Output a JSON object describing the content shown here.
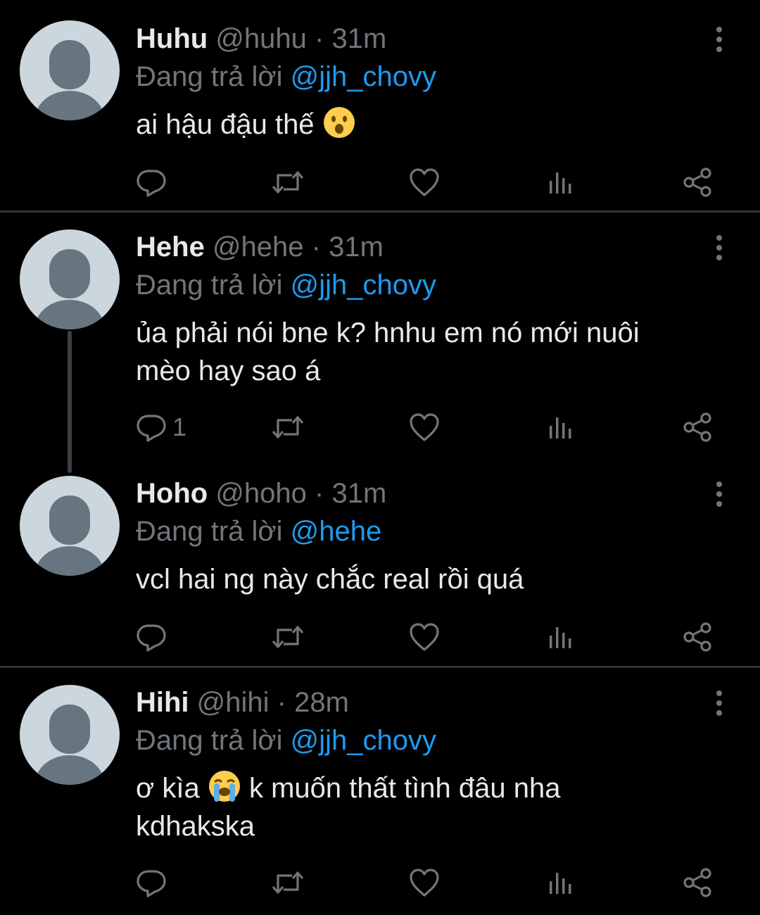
{
  "tweets": [
    {
      "name": "Huhu",
      "handle": "@huhu",
      "separator": "·",
      "time": "31m",
      "reply_prefix": "Đang trả lời",
      "reply_to": "@jjh_chovy",
      "text": "ai hậu đậu thế",
      "emoji": "astonished-face-emoji",
      "reply_count": ""
    },
    {
      "name": "Hehe",
      "handle": "@hehe",
      "separator": "·",
      "time": "31m",
      "reply_prefix": "Đang trả lời",
      "reply_to": "@jjh_chovy",
      "text_line1": "ủa phải nói bne k? hnhu em nó mới nuôi",
      "text_line2": "mèo hay sao á",
      "reply_count": "1"
    },
    {
      "name": "Hoho",
      "handle": "@hoho",
      "separator": "·",
      "time": "31m",
      "reply_prefix": "Đang trả lời",
      "reply_to": "@hehe",
      "text": "vcl hai ng này chắc real rồi quá",
      "reply_count": ""
    },
    {
      "name": "Hihi",
      "handle": "@hihi",
      "separator": "·",
      "time": "28m",
      "reply_prefix": "Đang trả lời",
      "reply_to": "@jjh_chovy",
      "text_before_emoji": "ơ kìa",
      "emoji": "loudly-crying-face-emoji",
      "text_after_emoji": "k muốn thất tình đâu nha",
      "text_line2": "kdhakska",
      "reply_count": ""
    }
  ],
  "icons": {
    "reply": "reply-icon",
    "retweet": "retweet-icon",
    "like": "heart-icon",
    "views": "views-icon",
    "share": "share-icon",
    "more": "more-vertical-icon"
  },
  "colors": {
    "background": "#000000",
    "text": "#e7e9ea",
    "secondary": "#71767b",
    "mention": "#1d9bf0",
    "divider": "#2f3336",
    "avatar_bg": "#ccd6dd",
    "avatar_fg": "#66757f"
  }
}
